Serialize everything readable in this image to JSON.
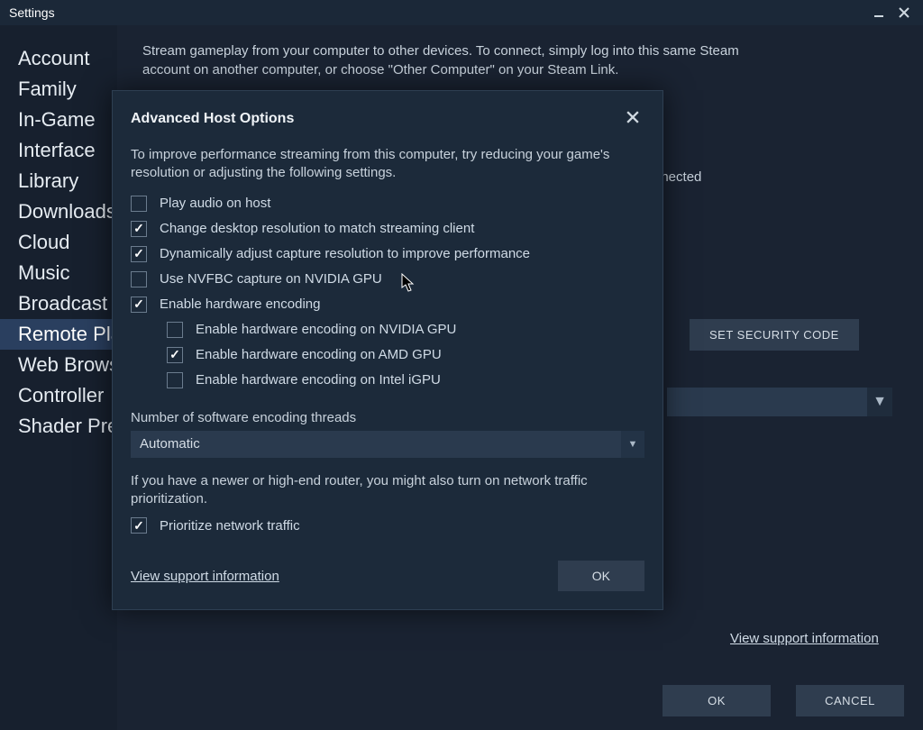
{
  "window": {
    "title": "Settings"
  },
  "sidebar": {
    "items": [
      {
        "label": "Account",
        "active": false
      },
      {
        "label": "Family",
        "active": false
      },
      {
        "label": "In-Game",
        "active": false
      },
      {
        "label": "Interface",
        "active": false
      },
      {
        "label": "Library",
        "active": false
      },
      {
        "label": "Downloads",
        "active": false
      },
      {
        "label": "Cloud",
        "active": false
      },
      {
        "label": "Music",
        "active": false
      },
      {
        "label": "Broadcast",
        "active": false
      },
      {
        "label": "Remote Play",
        "active": true
      },
      {
        "label": "Web Browser",
        "active": false
      },
      {
        "label": "Controller",
        "active": false
      },
      {
        "label": "Shader Pre-Caching",
        "active": false
      }
    ]
  },
  "remoteplay": {
    "intro": "Stream gameplay from your computer to other devices. To connect, simply log into this same Steam account on another computer, or choose \"Other Computer\" on your Steam Link.",
    "status_suffix": "nnected",
    "set_security_label": "SET SECURITY CODE",
    "support_link": "View support information",
    "ok_label": "OK",
    "cancel_label": "CANCEL"
  },
  "dialog": {
    "title": "Advanced Host Options",
    "intro": "To improve performance streaming from this computer, try reducing your game's resolution or adjusting the following settings.",
    "options": [
      {
        "label": "Play audio on host",
        "checked": false
      },
      {
        "label": "Change desktop resolution to match streaming client",
        "checked": true
      },
      {
        "label": "Dynamically adjust capture resolution to improve performance",
        "checked": true
      },
      {
        "label": "Use NVFBC capture on NVIDIA GPU",
        "checked": false
      },
      {
        "label": "Enable hardware encoding",
        "checked": true
      }
    ],
    "sub_options": [
      {
        "label": "Enable hardware encoding on NVIDIA GPU",
        "checked": false
      },
      {
        "label": "Enable hardware encoding on AMD GPU",
        "checked": true
      },
      {
        "label": "Enable hardware encoding on Intel iGPU",
        "checked": false
      }
    ],
    "threads_label": "Number of software encoding threads",
    "threads_value": "Automatic",
    "router_hint": "If you have a newer or high-end router, you might also turn on network traffic prioritization.",
    "prioritize": {
      "label": "Prioritize network traffic",
      "checked": true
    },
    "support_link": "View support information",
    "ok_label": "OK"
  }
}
